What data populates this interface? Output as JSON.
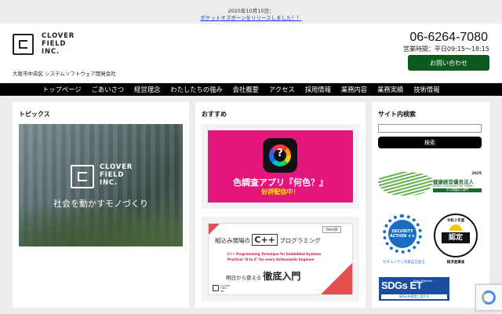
{
  "announcement": {
    "date": "2025年10月15日：",
    "link_text": "ポケットオズボーンをリリースしました！！"
  },
  "header": {
    "logo_lines": [
      "CLOVER",
      "FIELD",
      "INC."
    ],
    "tagline": "大阪市中央区 システムソフトウェア開発会社",
    "phone": "06-6264-7080",
    "hours": "営業時間：平日09:15〜18:15",
    "contact_button": "お問い合わせ"
  },
  "nav": {
    "items": [
      "トップページ",
      "ごあいさつ",
      "経営理念",
      "わたしたちの強み",
      "会社概要",
      "アクセス",
      "採用情報",
      "業務内容",
      "業務実績",
      "技術情報"
    ]
  },
  "topics": {
    "title": "トピックス",
    "hero_logo_lines": [
      "CLOVER",
      "FIELD",
      "INC."
    ],
    "hero_caption": "社会を動かすモノづくり"
  },
  "recommend": {
    "title": "おすすめ",
    "banner1": {
      "icon_glyph": "?",
      "title": "色調査アプリ『何色？』",
      "subtitle": "好評配信中！"
    },
    "banner2": {
      "tag": "Web版",
      "line1_pre": "組込み現場の",
      "line1_big": "C++",
      "line1_post": "プログラミング",
      "en_line1": "C++ Programming Technique for Embedded Systems",
      "en_line2": "Practical \"A to Z\" for every Enthusiastic Engineer",
      "line2_pre": "明日から使える",
      "line2_big": "徹底入門",
      "logo_lines": [
        "CLOVER",
        "FIELD",
        "INC."
      ]
    }
  },
  "sidebar": {
    "title": "サイト内検索",
    "search_placeholder": "",
    "search_button": "検索",
    "health": {
      "year": "2025",
      "title": "健康経営優良法人",
      "en": "KENKO Investment for Health",
      "bar": "中小規模法人部門"
    },
    "security": {
      "inner": "SECURITY ACTION ★★",
      "label": "セキュリティ対策自己宣言"
    },
    "nintei": {
      "top": "令和２年度",
      "main": "認定",
      "label": "経済産業省"
    },
    "sdgs": {
      "main": "SDGs ET",
      "small": "Each-Together",
      "sub": "SDGsを経営に活かす"
    }
  },
  "colors": {
    "nav_bg": "#000000",
    "contact_bg": "#0b5a1e",
    "banner_pink": "#e5157e",
    "link": "#1a3fbf"
  }
}
